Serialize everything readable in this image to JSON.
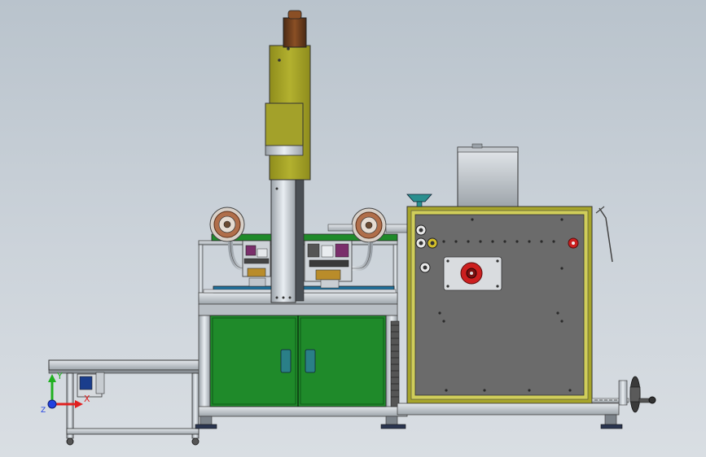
{
  "scene": {
    "subject": "cad-machine-assembly-render",
    "axis_triad": {
      "x_label": "X",
      "y_label": "Y",
      "z_label": "Z"
    },
    "colors": {
      "background_top": "#b9c3cc",
      "background_bottom": "#d9dee3",
      "olive_housing": "#a7a52a",
      "green_cabinet": "#1f8a2a",
      "gray_panel": "#6d6d6d",
      "frame_silver": "#d8dde2",
      "red_accent": "#cc1f1f",
      "axis_x": "#e02020",
      "axis_y": "#20b020",
      "axis_z": "#2040e0"
    }
  }
}
